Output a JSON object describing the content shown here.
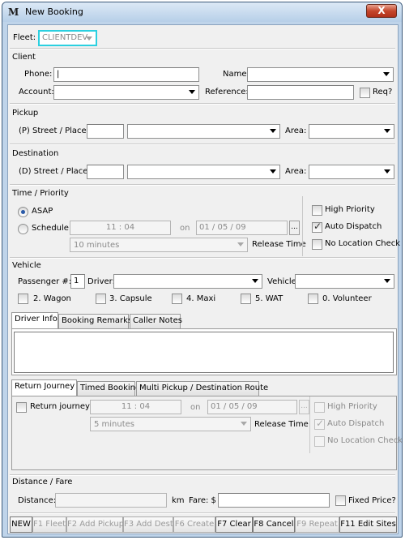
{
  "window": {
    "title": "New Booking",
    "logo": "M",
    "close_symbol": "X"
  },
  "fleet": {
    "label": "Fleet:",
    "value": "CLIENTDEV",
    "accent": "#2bd0e0"
  },
  "client": {
    "header": "Client",
    "phone_label": "Phone:",
    "phone_value": "|",
    "name_label": "Name:",
    "account_label": "Account:",
    "reference_label": "Reference:",
    "req_label": "Req?"
  },
  "pickup": {
    "header": "Pickup",
    "street_label": "(P) Street / Place:",
    "area_label": "Area:"
  },
  "destination": {
    "header": "Destination",
    "street_label": "(D) Street / Place:",
    "area_label": "Area:"
  },
  "time": {
    "header": "Time / Priority",
    "asap_label": "ASAP",
    "schedule_label": "Schedule",
    "time_value": "11 : 04",
    "on_label": "on",
    "date_value": "01 / 05 / 09",
    "release_value": "10 minutes",
    "release_label": "Release Time",
    "high_priority": "High Priority",
    "auto_dispatch": "Auto Dispatch",
    "no_location": "No Location Check"
  },
  "vehicle": {
    "header": "Vehicle",
    "passenger_label": "Passenger #:",
    "passenger_value": "1",
    "driver_label": "Driver:",
    "vehicle_label": "Vehicle:",
    "options": [
      "2. Wagon",
      "3. Capsule",
      "4. Maxi",
      "5. WAT",
      "0. Volunteer"
    ]
  },
  "info_tabs": [
    "Driver Info",
    "Booking Remarks",
    "Caller Notes"
  ],
  "journey_tabs": [
    "Return Journey",
    "Timed Booking",
    "Multi Pickup / Destination Route"
  ],
  "return": {
    "checkbox_label": "Return journey",
    "time_value": "11 : 04",
    "on_label": "on",
    "date_value": "01 / 05 / 09",
    "release_value": "5 minutes",
    "release_label": "Release Time",
    "high_priority": "High Priority",
    "auto_dispatch": "Auto Dispatch",
    "no_location": "No Location Check"
  },
  "fare": {
    "header": "Distance / Fare",
    "distance_label": "Distance:",
    "km_label": "km",
    "fare_label": "Fare: $",
    "fixed_label": "Fixed Price?"
  },
  "fkeys": [
    "NEW",
    "F1 Fleet",
    "F2 Add Pickup",
    "F3 Add Dest",
    "F6 Create",
    "F7 Clear",
    "F8 Cancel",
    "F9 Repeat",
    "F11 Edit Sites"
  ]
}
